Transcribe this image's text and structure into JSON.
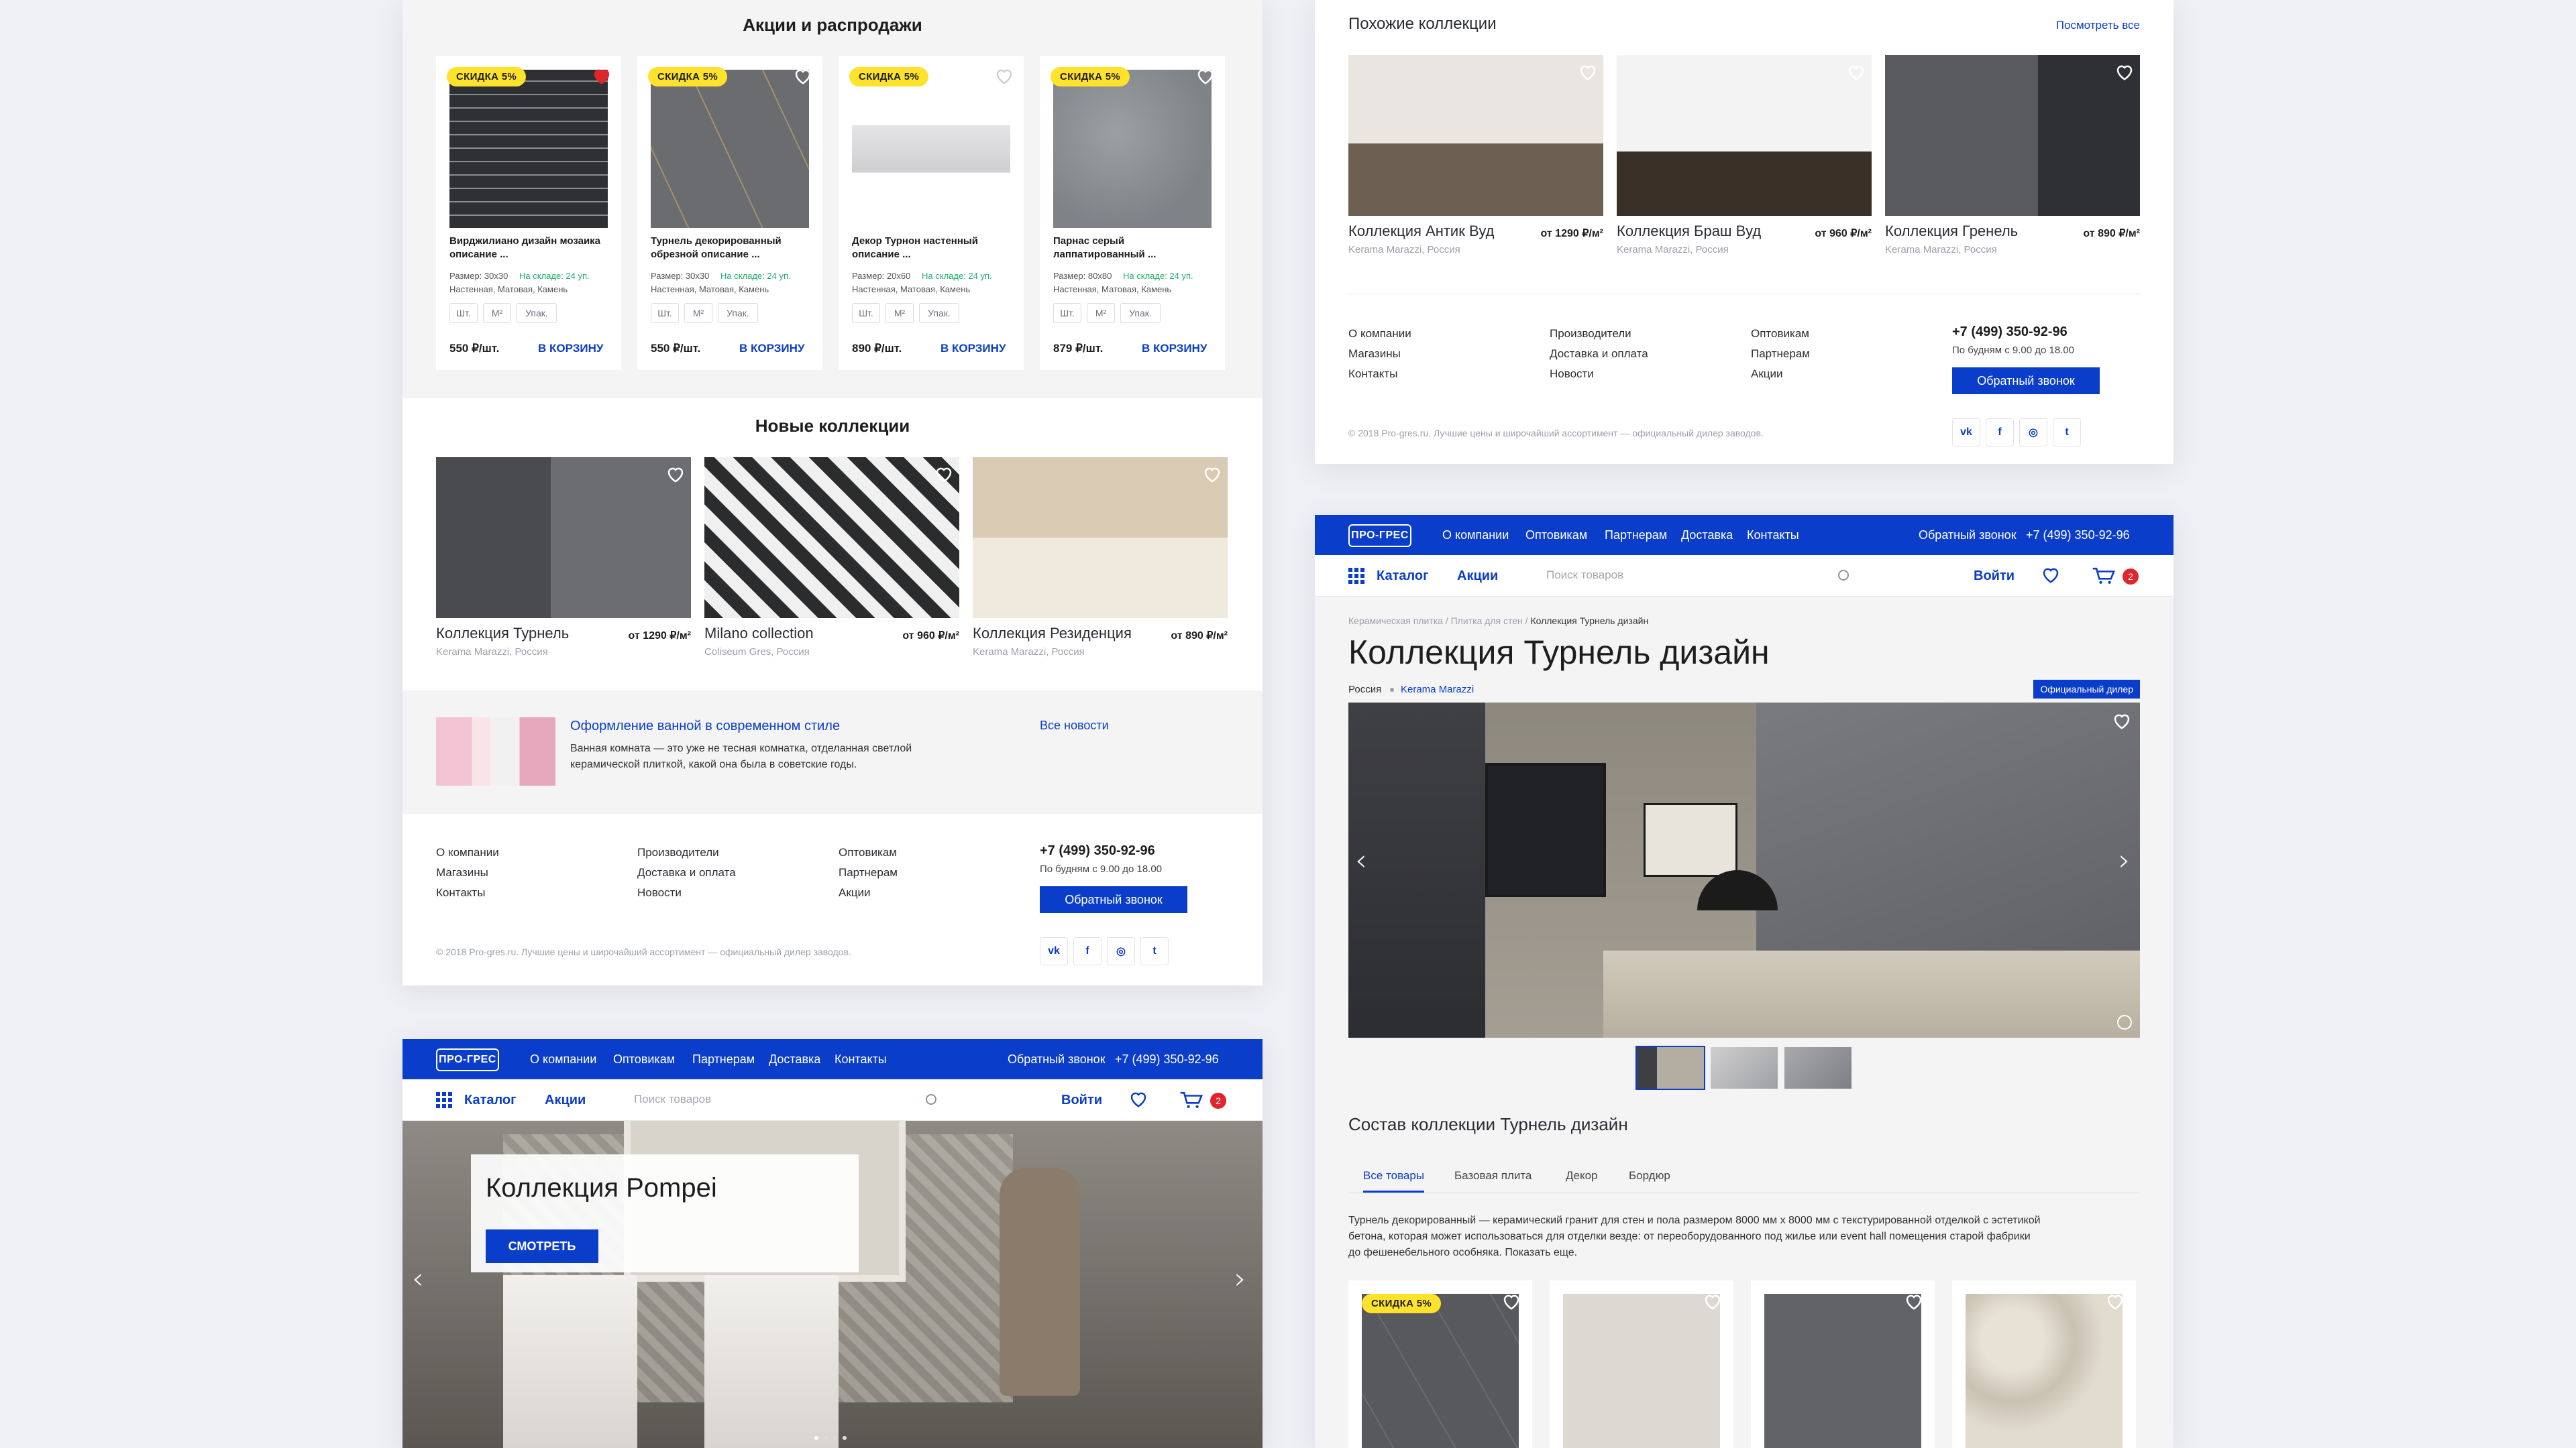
{
  "panel1": {
    "promo_title": "Акции и распродажи",
    "products": [
      {
        "badge": "СКИДКА 5%",
        "name": "Вирджилиано дизайн мозаика описание ...",
        "size": "Размер: 30x30",
        "stock": "На складе: 24 уп.",
        "props": "Настенная, Матовая, Камень",
        "units": [
          "Шт.",
          "М²",
          "Упак."
        ],
        "price": "550 ₽/шт.",
        "cart": "В КОРЗИНУ"
      },
      {
        "badge": "СКИДКА 5%",
        "name": "Турнель декорированный обрезной описание ...",
        "size": "Размер: 30x30",
        "stock": "На складе: 24 уп.",
        "props": "Настенная, Матовая, Камень",
        "units": [
          "Шт.",
          "М²",
          "Упак."
        ],
        "price": "550 ₽/шт.",
        "cart": "В КОРЗИНУ"
      },
      {
        "badge": "СКИДКА 5%",
        "name": "Декор Турнон настенный описание ...",
        "size": "Размер: 20x60",
        "stock": "На складе: 24 уп.",
        "props": "Настенная, Матовая, Камень",
        "units": [
          "Шт.",
          "М²",
          "Упак."
        ],
        "price": "890 ₽/шт.",
        "cart": "В КОРЗИНУ"
      },
      {
        "badge": "СКИДКА 5%",
        "name": "Парнас серый лаппатированный ...",
        "size": "Размер: 80x80",
        "stock": "На складе: 24 уп.",
        "props": "Настенная, Матовая, Камень",
        "units": [
          "Шт.",
          "М²",
          "Упак."
        ],
        "price": "879 ₽/шт.",
        "cart": "В КОРЗИНУ"
      }
    ],
    "new_title": "Новые коллекции",
    "collections": [
      {
        "name": "Коллекция Турнель",
        "price": "от 1290 ₽/м²",
        "sub": "Kerama Marazzi, Россия"
      },
      {
        "name": "Milano collection",
        "price": "от 960 ₽/м²",
        "sub": "Coliseum Gres, Россия"
      },
      {
        "name": "Коллекция Резиденция",
        "price": "от 890 ₽/м²",
        "sub": "Kerama Marazzi, Россия"
      }
    ],
    "news": {
      "title": "Оформление ванной в современном стиле",
      "text1": "Ванная комната — это уже не тесная комнатка, отделанная светлой",
      "text2": "керамической плиткой, какой она была в советские годы.",
      "all": "Все новости"
    }
  },
  "footer": {
    "col1": [
      "О компании",
      "Магазины",
      "Контакты"
    ],
    "col2": [
      "Производители",
      "Доставка и оплата",
      "Новости"
    ],
    "col3": [
      "Оптовикам",
      "Партнерам",
      "Акции"
    ],
    "phone": "+7 (499) 350-92-96",
    "hours": "По будням с 9.00 до 18.00",
    "callback": "Обратный звонок",
    "copyright": "© 2018 Pro-gres.ru. Лучшие цены и широчайший ассортимент — официальный дилер заводов.",
    "social": [
      "vk",
      "f",
      "ig",
      "tw"
    ]
  },
  "panel2": {
    "title": "Похожие коллекции",
    "view_all": "Посмотреть все",
    "collections": [
      {
        "name": "Коллекция Антик Вуд",
        "price": "от 1290 ₽/м²",
        "sub": "Kerama Marazzi, Россия"
      },
      {
        "name": "Коллекция Браш Вуд",
        "price": "от 960 ₽/м²",
        "sub": "Kerama Marazzi, Россия"
      },
      {
        "name": "Коллекция Гренель",
        "price": "от 890 ₽/м²",
        "sub": "Kerama Marazzi, Россия"
      }
    ]
  },
  "header": {
    "logo": "ПРО-ГРЕС",
    "top_links": [
      "О компании",
      "Оптовикам",
      "Партнерам",
      "Доставка",
      "Контакты"
    ],
    "callback": "Обратный звонок",
    "phone": "+7 (499) 350-92-96",
    "catalog": "Каталог",
    "promo": "Акции",
    "search_placeholder": "Поиск товаров",
    "login": "Войти",
    "cart_count": "2"
  },
  "panel3": {
    "hero_title": "Коллекция Pompei",
    "hero_button": "СМОТРЕТЬ"
  },
  "panel4": {
    "breadcrumb": [
      "Керамическая плитка",
      "Плитка для стен",
      "Коллекция Турнель дизайн"
    ],
    "title": "Коллекция Турнель дизайн",
    "country": "Россия",
    "brand": "Kerama Marazzi",
    "dealer": "Официальный дилер",
    "composition_title": "Состав коллекции Турнель дизайн",
    "tabs": [
      "Все товары",
      "Базовая плита",
      "Декор",
      "Бордюр"
    ],
    "desc1": "Турнель декорированный — керамический гранит для стен и пола размером 8000 мм х 8000 мм с текстурированной отделкой с эстетикой",
    "desc2": "бетона, которая может использоваться для отделки везде: от переоборудованного под жилье или event hall помещения старой фабрики",
    "desc3": "до фешенебельного особняка. Показать еще.",
    "badge": "СКИДКА 5%"
  },
  "colors": {
    "accent": "#0a3dc9",
    "badge": "#ffe22b",
    "heart_active": "#e0262c",
    "stock": "#1fae6a"
  }
}
